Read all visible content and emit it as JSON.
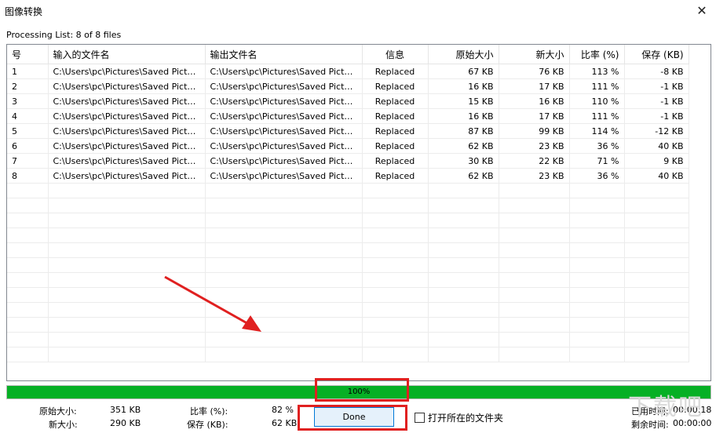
{
  "window": {
    "title": "图像转换"
  },
  "processing_label": "Processing List: 8 of 8 files",
  "table": {
    "headers": [
      "号",
      "输入的文件名",
      "输出文件名",
      "信息",
      "原始大小",
      "新大小",
      "比率 (%)",
      "保存 (KB)"
    ],
    "rows": [
      [
        "1",
        "C:\\Users\\pc\\Pictures\\Saved Pictures...",
        "C:\\Users\\pc\\Pictures\\Saved Pictures...",
        "Replaced",
        "67 KB",
        "76 KB",
        "113 %",
        "-8 KB"
      ],
      [
        "2",
        "C:\\Users\\pc\\Pictures\\Saved Pictures...",
        "C:\\Users\\pc\\Pictures\\Saved Pictures...",
        "Replaced",
        "16 KB",
        "17 KB",
        "111 %",
        "-1 KB"
      ],
      [
        "3",
        "C:\\Users\\pc\\Pictures\\Saved Pictures...",
        "C:\\Users\\pc\\Pictures\\Saved Pictures...",
        "Replaced",
        "15 KB",
        "16 KB",
        "110 %",
        "-1 KB"
      ],
      [
        "4",
        "C:\\Users\\pc\\Pictures\\Saved Pictures...",
        "C:\\Users\\pc\\Pictures\\Saved Pictures...",
        "Replaced",
        "16 KB",
        "17 KB",
        "111 %",
        "-1 KB"
      ],
      [
        "5",
        "C:\\Users\\pc\\Pictures\\Saved Pictures...",
        "C:\\Users\\pc\\Pictures\\Saved Pictures...",
        "Replaced",
        "87 KB",
        "99 KB",
        "114 %",
        "-12 KB"
      ],
      [
        "6",
        "C:\\Users\\pc\\Pictures\\Saved Pictures...",
        "C:\\Users\\pc\\Pictures\\Saved Pictures...",
        "Replaced",
        "62 KB",
        "23 KB",
        "36 %",
        "40 KB"
      ],
      [
        "7",
        "C:\\Users\\pc\\Pictures\\Saved Pictures...",
        "C:\\Users\\pc\\Pictures\\Saved Pictures...",
        "Replaced",
        "30 KB",
        "22 KB",
        "71 %",
        "9 KB"
      ],
      [
        "8",
        "C:\\Users\\pc\\Pictures\\Saved Pictures...",
        "C:\\Users\\pc\\Pictures\\Saved Pictures...",
        "Replaced",
        "62 KB",
        "23 KB",
        "36 %",
        "40 KB"
      ]
    ],
    "empty_rows": 12
  },
  "progress": {
    "percent": 100,
    "label": "100%",
    "color": "#06b025"
  },
  "stats": {
    "orig_label": "原始大小:",
    "orig_value": "351 KB",
    "new_label": "新大小:",
    "new_value": "290 KB",
    "ratio_label": "比率 (%):",
    "ratio_value": "82 %",
    "save_label": "保存 (KB):",
    "save_value": "62 KB"
  },
  "done_button": "Done",
  "open_folder_label": "打开所在的文件夹",
  "open_folder_checked": false,
  "time": {
    "elapsed_label": "已用时间:",
    "elapsed_value": "00:00:18",
    "remaining_label": "剩余时间:",
    "remaining_value": "00:00:00"
  },
  "watermark": "下载吧",
  "colors": {
    "annotation_red": "#e02020",
    "button_border": "#0078d7"
  }
}
